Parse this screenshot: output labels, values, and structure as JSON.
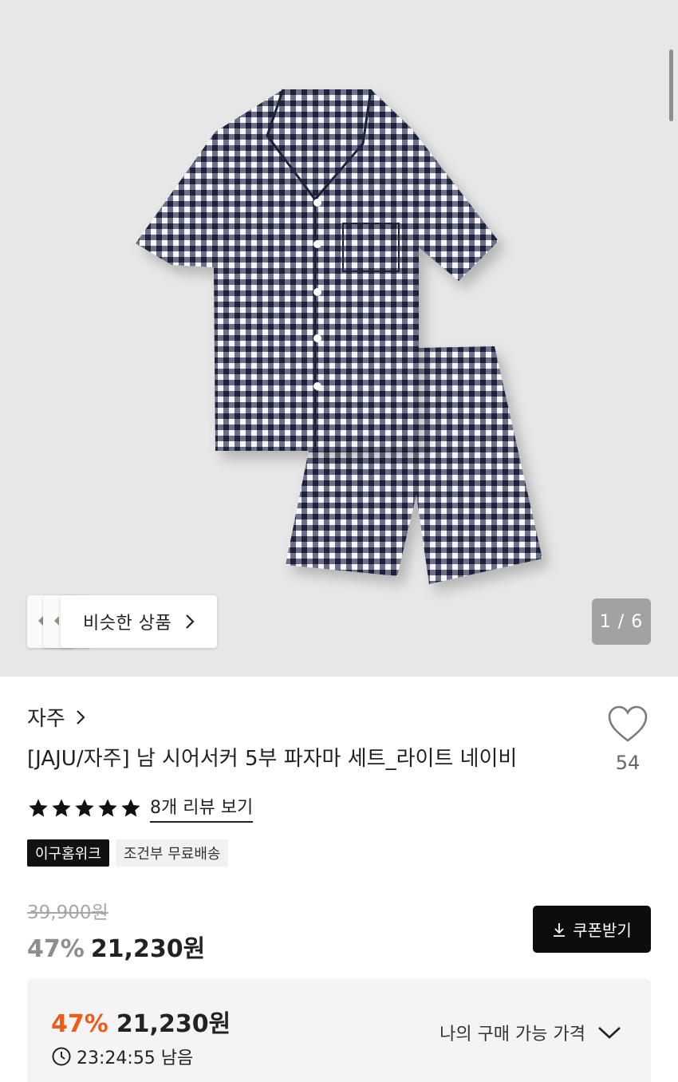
{
  "gallery": {
    "similar_label": "비슷한 상품",
    "pager": "1 / 6"
  },
  "product": {
    "brand": "자주",
    "title": "[JAJU/자주] 남 시어서커 5부 파자마 세트_라이트 네이비",
    "wish_count": "54",
    "rating_stars": 5,
    "review_link": "8개 리뷰 보기",
    "badges": [
      "이구홈위크",
      "조건부 무료배송"
    ],
    "original_price": "39,900원",
    "discount": "47%",
    "price": "21,230원",
    "coupon_label": "쿠폰받기"
  },
  "deal": {
    "discount": "47%",
    "price": "21,230원",
    "timer": "23:24:55 남음",
    "my_price_label": "나의 구매 가능 가격"
  },
  "colors": {
    "accent_orange": "#f05a1a",
    "hero_bg": "#e7e7e8",
    "button_dark": "#0d0d0d",
    "pajama_navy": "#1d2238"
  }
}
